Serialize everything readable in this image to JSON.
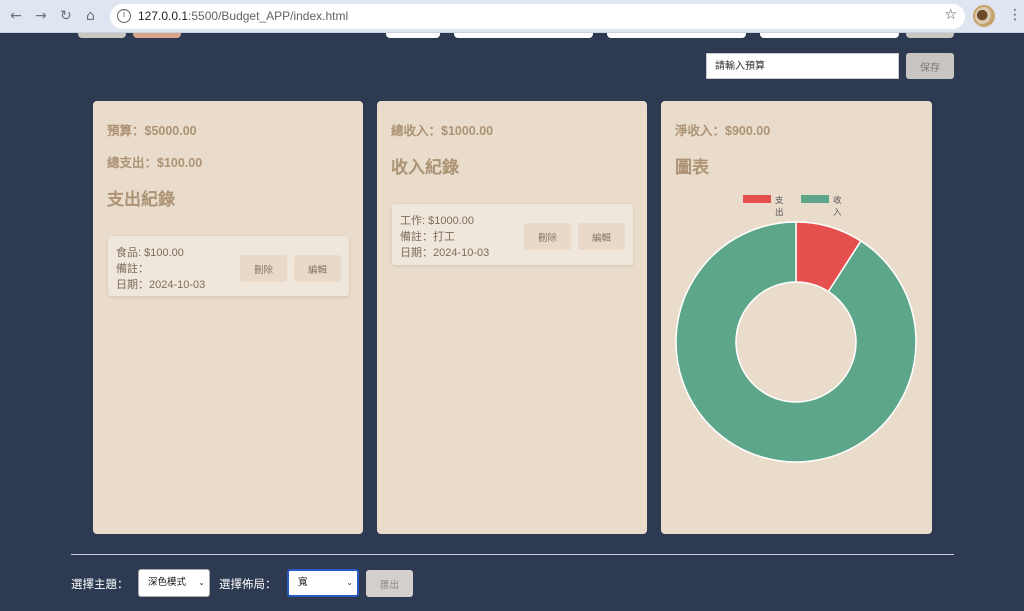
{
  "browser": {
    "url_host": "127.0.0.1",
    "url_path": ":5500/Budget_APP/index.html"
  },
  "budget": {
    "placeholder": "請輸入預算",
    "save_label": "保存"
  },
  "expense_card": {
    "budget_text": "預算：$5000.00",
    "total_expense_text": "總支出：$100.00",
    "heading": "支出紀錄",
    "records": [
      {
        "line1": "食品: $100.00",
        "line2": "備註：",
        "line3": "日期：2024-10-03",
        "delete_label": "刪除",
        "edit_label": "編輯"
      }
    ]
  },
  "income_card": {
    "total_income_text": "總收入：$1000.00",
    "heading": "收入紀錄",
    "records": [
      {
        "line1": "工作: $1000.00",
        "line2": "備註：打工",
        "line3": "日期：2024-10-03",
        "delete_label": "刪除",
        "edit_label": "編輯"
      }
    ]
  },
  "chart_card": {
    "net_income_text": "淨收入：$900.00",
    "heading": "圖表"
  },
  "chart_data": {
    "type": "pie",
    "variant": "doughnut",
    "categories": [
      "支出",
      "收入"
    ],
    "values": [
      100,
      1000
    ],
    "colors": [
      "#e5504e",
      "#5da68a"
    ],
    "legend": "top"
  },
  "footer": {
    "theme_label": "選擇主題：",
    "theme_value": "深色模式",
    "layout_label": "選擇佈局：",
    "layout_value": "寬",
    "logout_label": "匯出"
  },
  "colors": {
    "background": "#2e3a52",
    "card": "#eadccb",
    "accent_text": "#ac9375"
  }
}
